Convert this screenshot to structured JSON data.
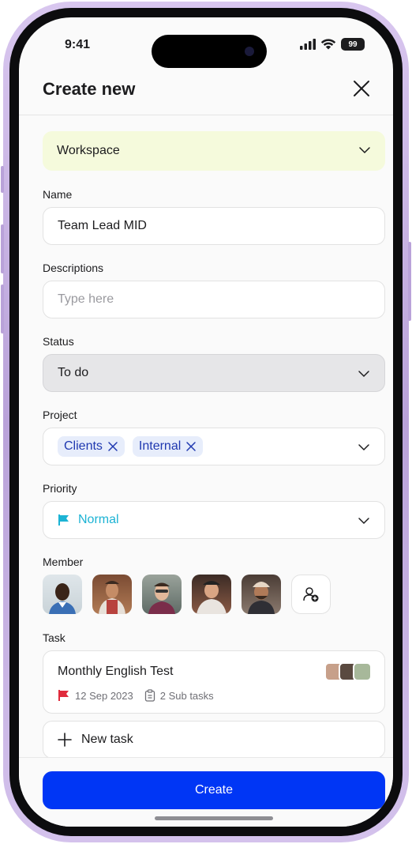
{
  "status_bar": {
    "time": "9:41",
    "battery": "99"
  },
  "header": {
    "title": "Create new"
  },
  "workspace": {
    "value": "Workspace"
  },
  "name": {
    "label": "Name",
    "value": "Team Lead MID"
  },
  "descriptions": {
    "label": "Descriptions",
    "placeholder": "Type here"
  },
  "status": {
    "label": "Status",
    "value": "To do"
  },
  "project": {
    "label": "Project",
    "chips": [
      "Clients",
      "Internal"
    ]
  },
  "priority": {
    "label": "Priority",
    "value": "Normal",
    "color": "#1cb3d4"
  },
  "member": {
    "label": "Member",
    "avatar_icons": [
      "person-avatar-1",
      "person-avatar-2",
      "person-avatar-3",
      "person-avatar-4",
      "person-avatar-5"
    ]
  },
  "task": {
    "label": "Task",
    "title": "Monthly English Test",
    "date": "12 Sep 2023",
    "subtasks": "2 Sub tasks",
    "new_task_label": "New task"
  },
  "footer": {
    "create_label": "Create",
    "accent": "#0036f5"
  }
}
